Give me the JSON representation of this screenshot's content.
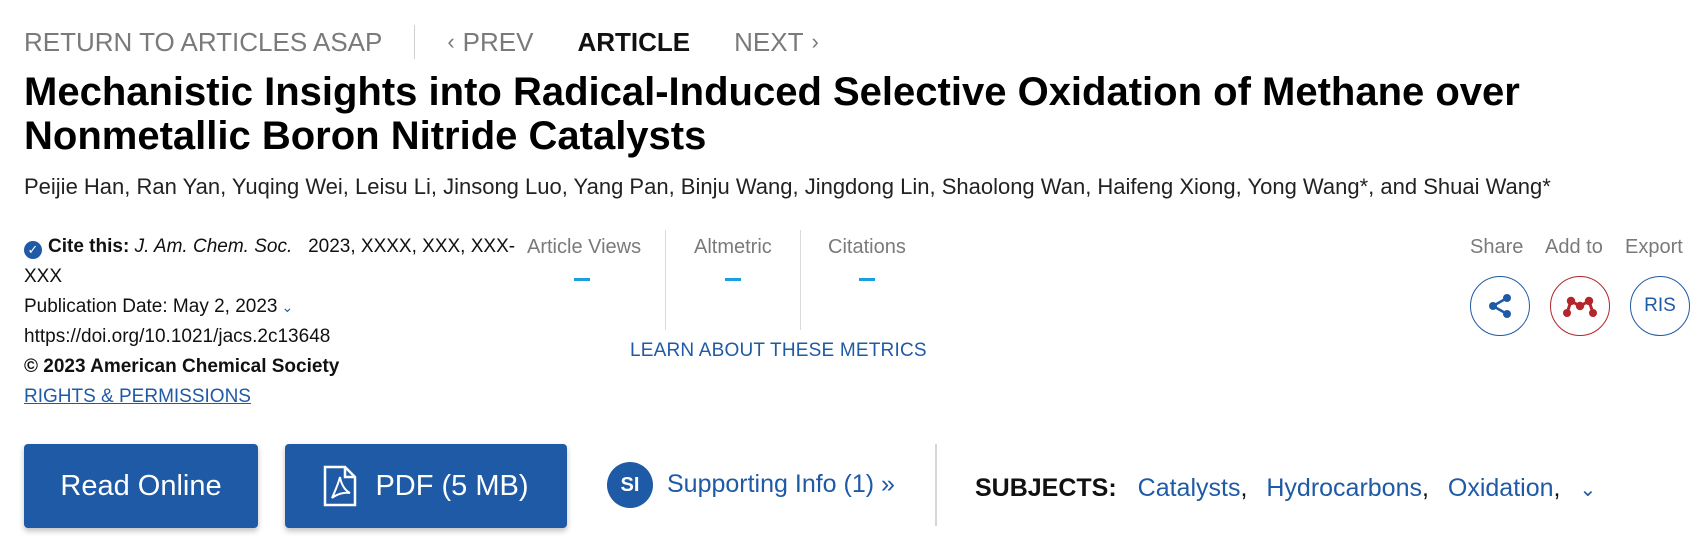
{
  "nav": {
    "return_label": "RETURN TO ARTICLES ASAP",
    "prev_label": "PREV",
    "current_label": "ARTICLE",
    "next_label": "NEXT"
  },
  "article": {
    "title": "Mechanistic Insights into Radical-Induced Selective Oxidation of Methane over Nonmetallic Boron Nitride Catalysts",
    "authors": "Peijie Han, Ran Yan, Yuqing Wei, Leisu Li, Jinsong Luo, Yang Pan, Binju Wang, Jingdong Lin, Shaolong Wan, Haifeng Xiong, Yong Wang*, and Shuai Wang*"
  },
  "citation": {
    "cite_label": "Cite this:",
    "journal": "J. Am. Chem. Soc.",
    "details": "2023, XXXX, XXX, XXX-XXX",
    "pub_date": "Publication Date: May 2, 2023",
    "doi": "https://doi.org/10.1021/jacs.2c13648",
    "copyright": "© 2023 American Chemical Society",
    "rights_link": "RIGHTS & PERMISSIONS"
  },
  "metrics": {
    "items": [
      {
        "label": "Article Views",
        "value": "-"
      },
      {
        "label": "Altmetric",
        "value": "-"
      },
      {
        "label": "Citations",
        "value": "-"
      }
    ],
    "learn_link": "LEARN ABOUT THESE METRICS",
    "dash_color": "#1aa0e0"
  },
  "actions": {
    "share_label": "Share",
    "add_label": "Add to",
    "export_label": "Export",
    "share_icon": "share-icon",
    "add_icon": "mendeley-icon",
    "export_text": "RIS"
  },
  "buttons": {
    "read_online": "Read Online",
    "pdf": "PDF (5 MB)",
    "si_badge": "SI",
    "supporting_info": "Supporting Info (1) »"
  },
  "subjects": {
    "label": "SUBJECTS:",
    "tags": [
      "Catalysts",
      "Hydrocarbons",
      "Oxidation"
    ]
  },
  "colors": {
    "brand_blue": "#1f5aa6",
    "mendeley_red": "#b3262b",
    "muted_gray": "#7a7a7a"
  }
}
